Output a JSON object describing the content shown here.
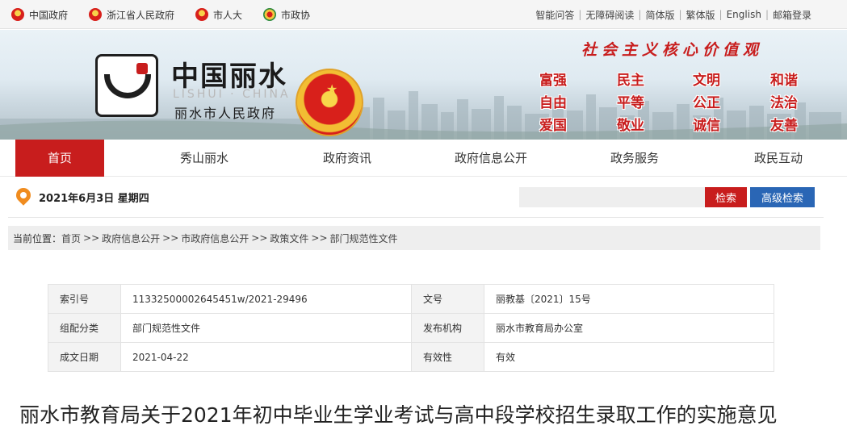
{
  "topbar": {
    "links": [
      {
        "label": "中国政府",
        "icon": "national-emblem-icon"
      },
      {
        "label": "浙江省人民政府",
        "icon": "zhejiang-emblem-icon"
      },
      {
        "label": "市人大",
        "icon": "national-emblem-icon"
      },
      {
        "label": "市政协",
        "icon": "cppcc-emblem-icon"
      }
    ],
    "utility": [
      "智能问答",
      "无障碍阅读",
      "简体版",
      "繁体版",
      "English",
      "邮箱登录"
    ]
  },
  "banner": {
    "title": "中国丽水",
    "pinyin": "LISHUI · CHINA",
    "subtitle": "丽水市人民政府",
    "values_title": "社会主义核心价值观",
    "values": [
      "富强",
      "民主",
      "文明",
      "和谐",
      "自由",
      "平等",
      "公正",
      "法治",
      "爱国",
      "敬业",
      "诚信",
      "友善"
    ]
  },
  "nav": {
    "items": [
      "首页",
      "秀山丽水",
      "政府资讯",
      "政府信息公开",
      "政务服务",
      "政民互动"
    ],
    "active_index": 0
  },
  "daterow": {
    "date": "2021年6月3日 星期四",
    "search_value": "",
    "search_label": "检索",
    "advanced_label": "高级检索"
  },
  "breadcrumb": {
    "label": "当前位置：",
    "items": [
      "首页",
      "政府信息公开",
      "市政府信息公开",
      "政策文件",
      "部门规范性文件"
    ],
    "separator": ">>"
  },
  "info": {
    "rows": [
      {
        "k1": "索引号",
        "v1": "11332500002645451w/2021-29496",
        "k2": "文号",
        "v2": "丽教基〔2021〕15号"
      },
      {
        "k1": "组配分类",
        "v1": "部门规范性文件",
        "k2": "发布机构",
        "v2": "丽水市教育局办公室"
      },
      {
        "k1": "成文日期",
        "v1": "2021-04-22",
        "k2": "有效性",
        "v2": "有效"
      }
    ]
  },
  "document": {
    "title": "丽水市教育局关于2021年初中毕业生学业考试与高中段学校招生录取工作的实施意见"
  },
  "colors": {
    "primary_red": "#c81d1d",
    "secondary_blue": "#2a66b5",
    "accent_orange": "#f08c1f"
  }
}
